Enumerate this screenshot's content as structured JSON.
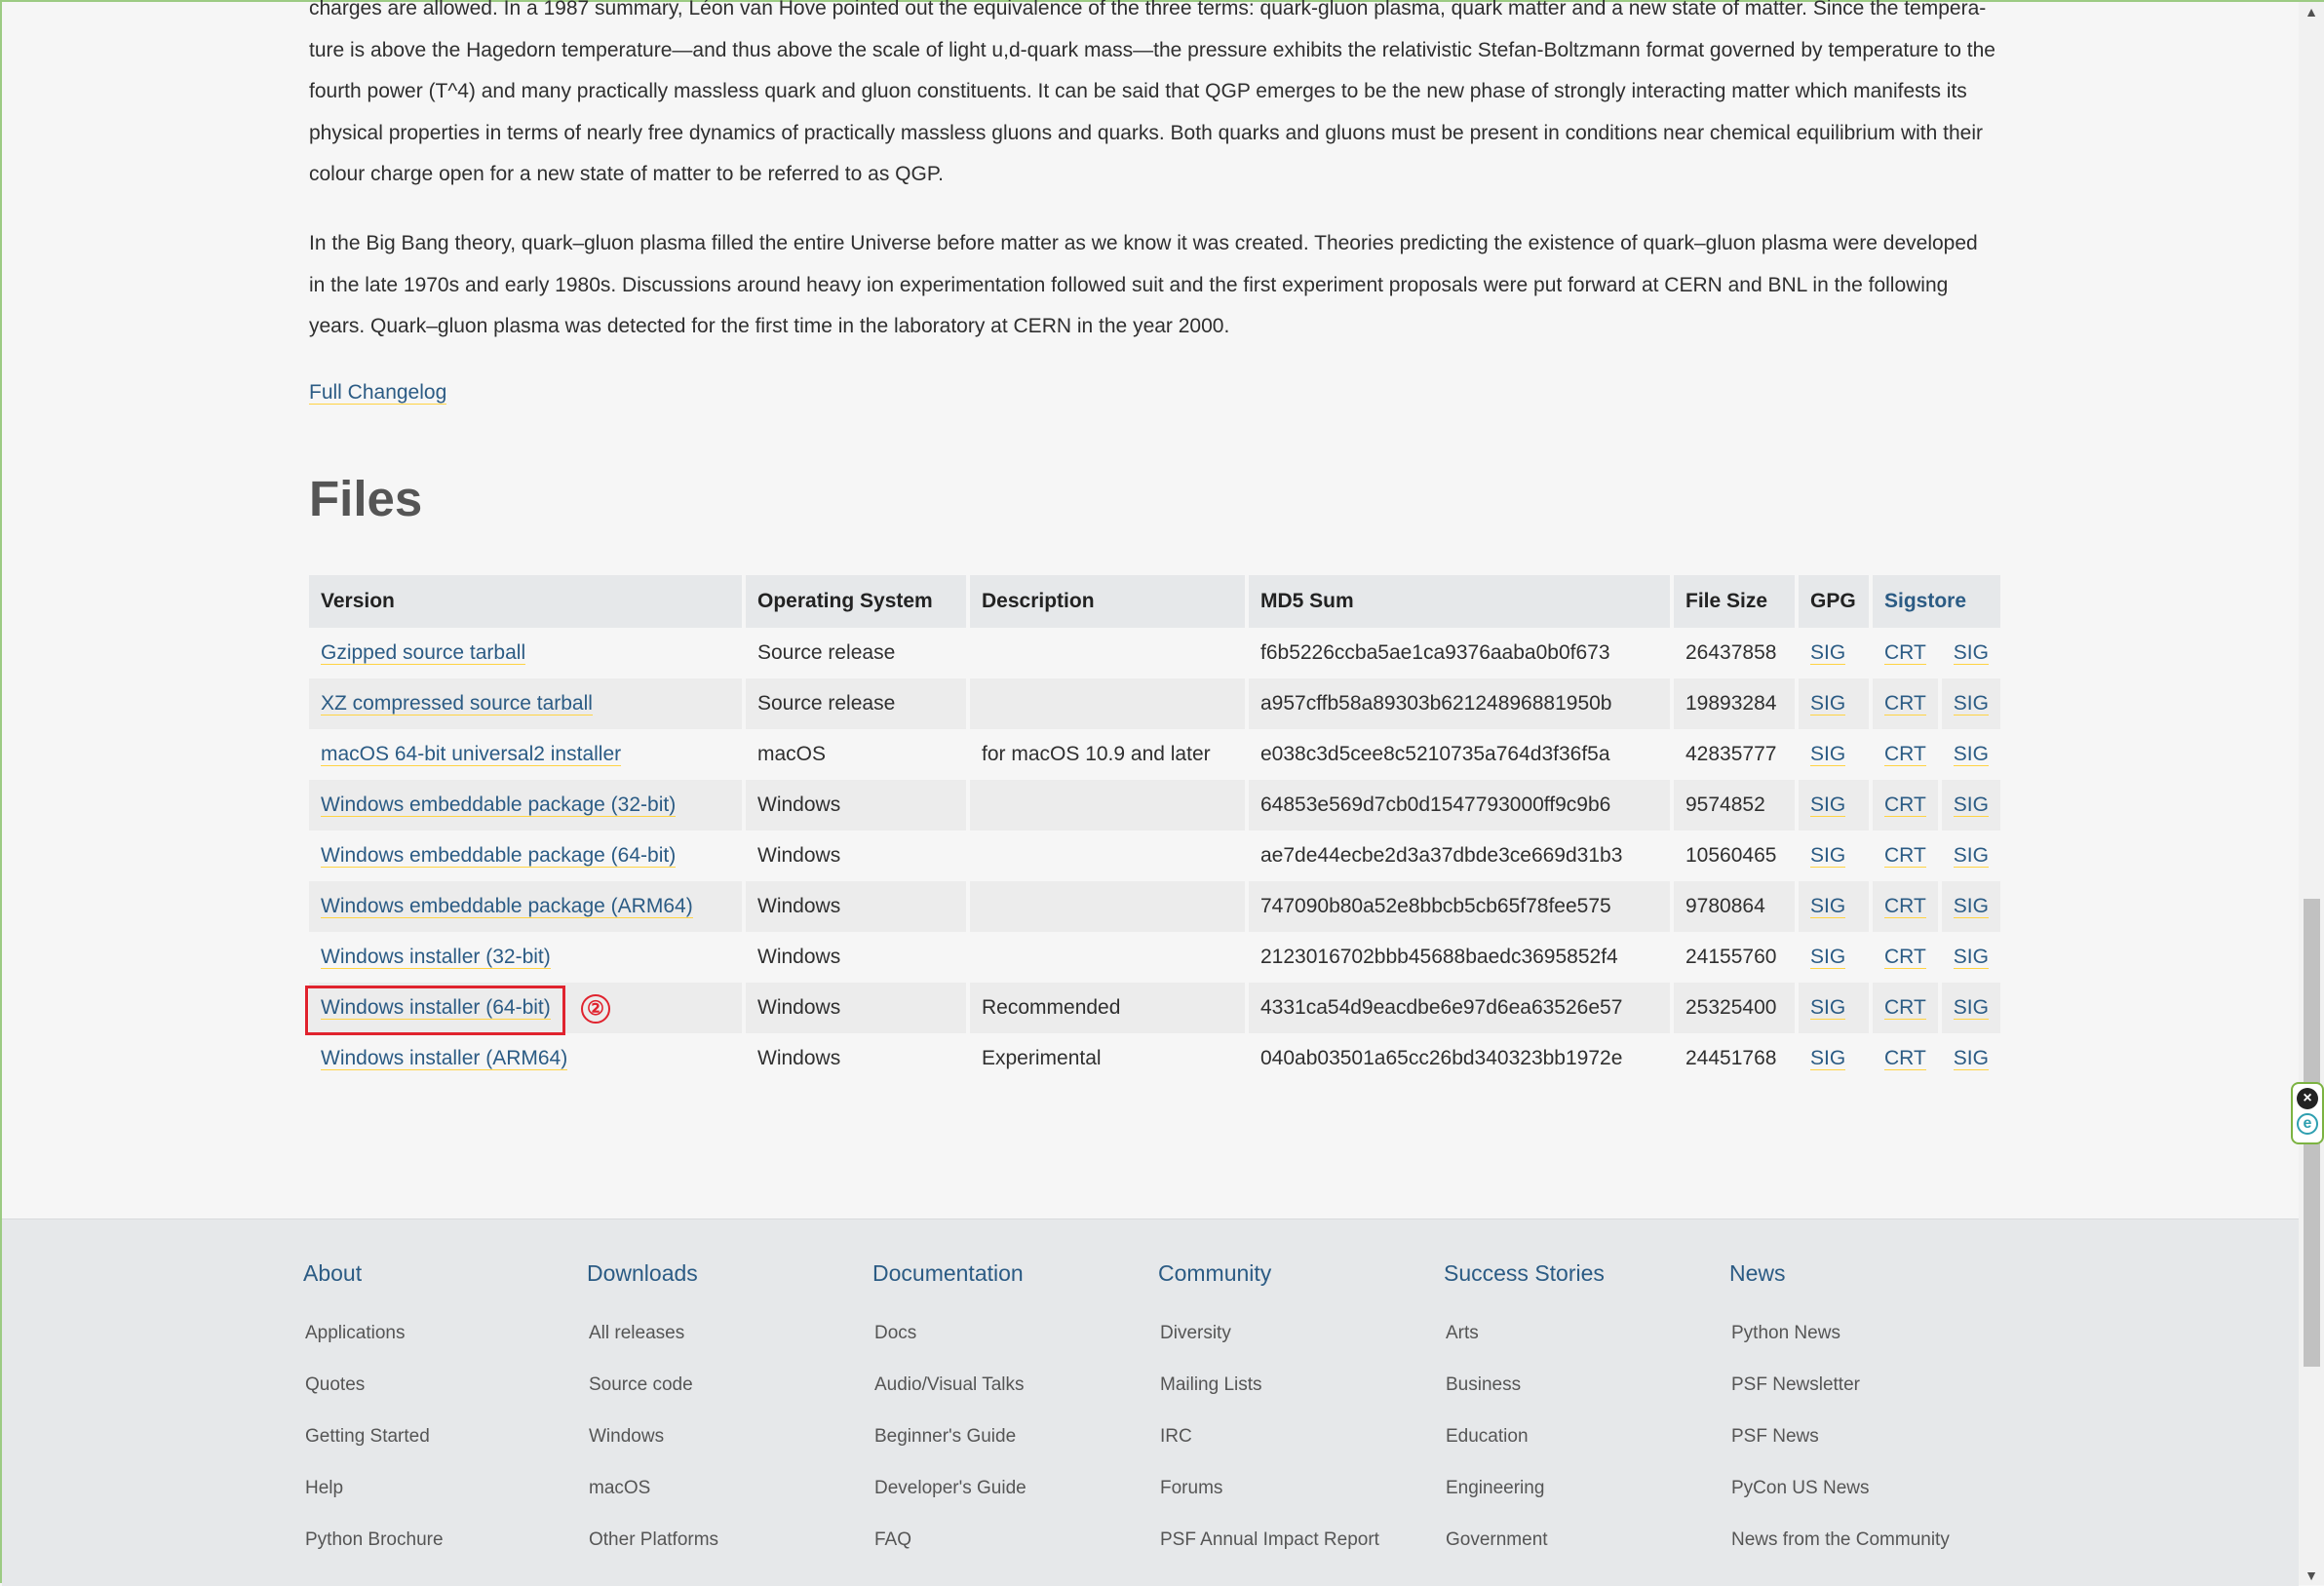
{
  "article": {
    "paragraphs": [
      "charges are allowed. In a 1987 summary, Léon van Hove pointed out the equivalence of the three terms: quark-gluon plasma, quark matter and a new state of matter. Since the tempera-ture is above the Hagedorn temperature—and thus above the scale of light u,d-quark mass—the pressure exhibits the relativistic Stefan-Boltzmann format governed by temperature to the fourth power (T^4) and many practically massless quark and gluon constituents. It can be said that QGP emerges to be the new phase of strongly interacting matter which manifests its physical properties in terms of nearly free dynamics of practically massless gluons and quarks. Both quarks and gluons must be present in conditions near chemical equilibrium with their colour charge open for a new state of matter to be referred to as QGP.",
      "In the Big Bang theory, quark–gluon plasma filled the entire Universe before matter as we know it was created. Theories predicting the existence of quark–gluon plasma were developed in the late 1970s and early 1980s. Discussions around heavy ion experimentation followed suit and the first experiment proposals were put forward at CERN and BNL in the following years. Quark–gluon plasma was detected for the first time in the laboratory at CERN in the year 2000."
    ],
    "changelog_label": "Full Changelog"
  },
  "files": {
    "title": "Files",
    "headers": {
      "version": "Version",
      "os": "Operating System",
      "description": "Description",
      "md5": "MD5 Sum",
      "size": "File Size",
      "gpg": "GPG",
      "sigstore": "Sigstore"
    },
    "rows": [
      {
        "version": "Gzipped source tarball",
        "os": "Source release",
        "description": "",
        "md5": "f6b5226ccba5ae1ca9376aaba0b0f673",
        "size": "26437858",
        "gpg": "SIG",
        "crt": "CRT",
        "sig": "SIG"
      },
      {
        "version": "XZ compressed source tarball",
        "os": "Source release",
        "description": "",
        "md5": "a957cffb58a89303b62124896881950b",
        "size": "19893284",
        "gpg": "SIG",
        "crt": "CRT",
        "sig": "SIG"
      },
      {
        "version": "macOS 64-bit universal2 installer",
        "os": "macOS",
        "description": "for macOS 10.9 and later",
        "md5": "e038c3d5cee8c5210735a764d3f36f5a",
        "size": "42835777",
        "gpg": "SIG",
        "crt": "CRT",
        "sig": "SIG"
      },
      {
        "version": "Windows embeddable package (32-bit)",
        "os": "Windows",
        "description": "",
        "md5": "64853e569d7cb0d1547793000ff9c9b6",
        "size": "9574852",
        "gpg": "SIG",
        "crt": "CRT",
        "sig": "SIG"
      },
      {
        "version": "Windows embeddable package (64-bit)",
        "os": "Windows",
        "description": "",
        "md5": "ae7de44ecbe2d3a37dbde3ce669d31b3",
        "size": "10560465",
        "gpg": "SIG",
        "crt": "CRT",
        "sig": "SIG"
      },
      {
        "version": "Windows embeddable package (ARM64)",
        "os": "Windows",
        "description": "",
        "md5": "747090b80a52e8bbcb5cb65f78fee575",
        "size": "9780864",
        "gpg": "SIG",
        "crt": "CRT",
        "sig": "SIG"
      },
      {
        "version": "Windows installer (32-bit)",
        "os": "Windows",
        "description": "",
        "md5": "2123016702bbb45688baedc3695852f4",
        "size": "24155760",
        "gpg": "SIG",
        "crt": "CRT",
        "sig": "SIG"
      },
      {
        "version": "Windows installer (64-bit)",
        "os": "Windows",
        "description": "Recommended",
        "md5": "4331ca54d9eacdbe6e97d6ea63526e57",
        "size": "25325400",
        "gpg": "SIG",
        "crt": "CRT",
        "sig": "SIG"
      },
      {
        "version": "Windows installer (ARM64)",
        "os": "Windows",
        "description": "Experimental",
        "md5": "040ab03501a65cc26bd340323bb1972e",
        "size": "24451768",
        "gpg": "SIG",
        "crt": "CRT",
        "sig": "SIG"
      }
    ]
  },
  "annotation": {
    "step_label": "②",
    "highlight_color": "#e0232e"
  },
  "footer": {
    "columns": [
      {
        "title": "About",
        "items": [
          "Applications",
          "Quotes",
          "Getting Started",
          "Help",
          "Python Brochure"
        ]
      },
      {
        "title": "Downloads",
        "items": [
          "All releases",
          "Source code",
          "Windows",
          "macOS",
          "Other Platforms"
        ]
      },
      {
        "title": "Documentation",
        "items": [
          "Docs",
          "Audio/Visual Talks",
          "Beginner's Guide",
          "Developer's Guide",
          "FAQ"
        ]
      },
      {
        "title": "Community",
        "items": [
          "Diversity",
          "Mailing Lists",
          "IRC",
          "Forums",
          "PSF Annual Impact Report"
        ]
      },
      {
        "title": "Success Stories",
        "items": [
          "Arts",
          "Business",
          "Education",
          "Engineering",
          "Government"
        ]
      },
      {
        "title": "News",
        "items": [
          "Python News",
          "PSF Newsletter",
          "PSF News",
          "PyCon US News",
          "News from the Community"
        ]
      }
    ]
  },
  "icons": {
    "scroll_up": "chevron-up-icon",
    "scroll_down": "chevron-down-icon",
    "ext_close": "close-icon",
    "ext_e": "extension-e-icon"
  },
  "colors": {
    "link": "#2b5b84",
    "link_underline": "#ffd343",
    "highlight": "#e0232e"
  }
}
